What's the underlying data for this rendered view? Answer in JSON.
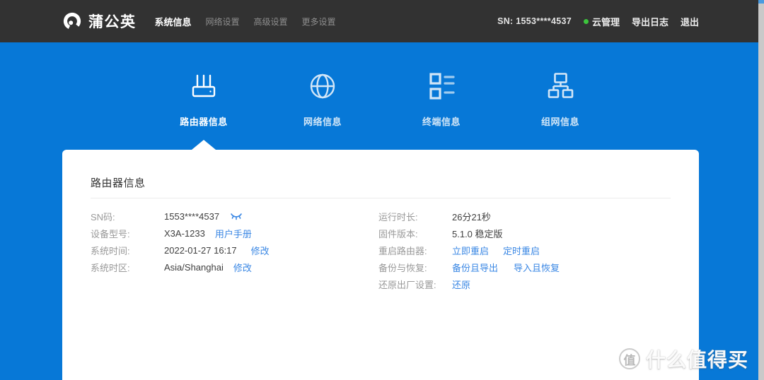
{
  "header": {
    "logo_text": "蒲公英",
    "nav": [
      {
        "label": "系统信息"
      },
      {
        "label": "网络设置"
      },
      {
        "label": "高级设置"
      },
      {
        "label": "更多设置"
      }
    ],
    "sn_label": "SN: 1553****4537",
    "cloud_status": "云管理",
    "export_log": "导出日志",
    "logout": "退出"
  },
  "tabs": [
    {
      "label": "路由器信息",
      "icon": "router-icon",
      "active": true
    },
    {
      "label": "网络信息",
      "icon": "globe-icon",
      "active": false
    },
    {
      "label": "终端信息",
      "icon": "terminal-list-icon",
      "active": false
    },
    {
      "label": "组网信息",
      "icon": "network-topology-icon",
      "active": false
    }
  ],
  "card": {
    "title": "路由器信息",
    "left_rows": [
      {
        "label": "SN码:",
        "value": "1553****4537",
        "icon": "eye-closed-icon"
      },
      {
        "label": "设备型号:",
        "value": "X3A-1233",
        "links": [
          "用户手册"
        ]
      },
      {
        "label": "系统时间:",
        "value": "2022-01-27 16:17",
        "links": [
          "修改"
        ]
      },
      {
        "label": "系统时区:",
        "value": "Asia/Shanghai",
        "links": [
          "修改"
        ]
      }
    ],
    "right_rows": [
      {
        "label": "运行时长:",
        "value": "26分21秒"
      },
      {
        "label": "固件版本:",
        "value": "5.1.0 稳定版"
      },
      {
        "label": "重启路由器:",
        "links": [
          "立即重启",
          "定时重启"
        ]
      },
      {
        "label": "备份与恢复:",
        "links": [
          "备份且导出",
          "导入且恢复"
        ]
      },
      {
        "label": "还原出厂设置:",
        "links": [
          "还原"
        ]
      }
    ]
  },
  "watermark": {
    "badge": "值",
    "text": "什么值得买"
  },
  "colors": {
    "primary_blue": "#0778d7",
    "header_bg": "#323232",
    "link_blue": "#3a87e4",
    "online_green": "#3cc53c",
    "label_gray": "#999999",
    "value_dark": "#404040"
  }
}
